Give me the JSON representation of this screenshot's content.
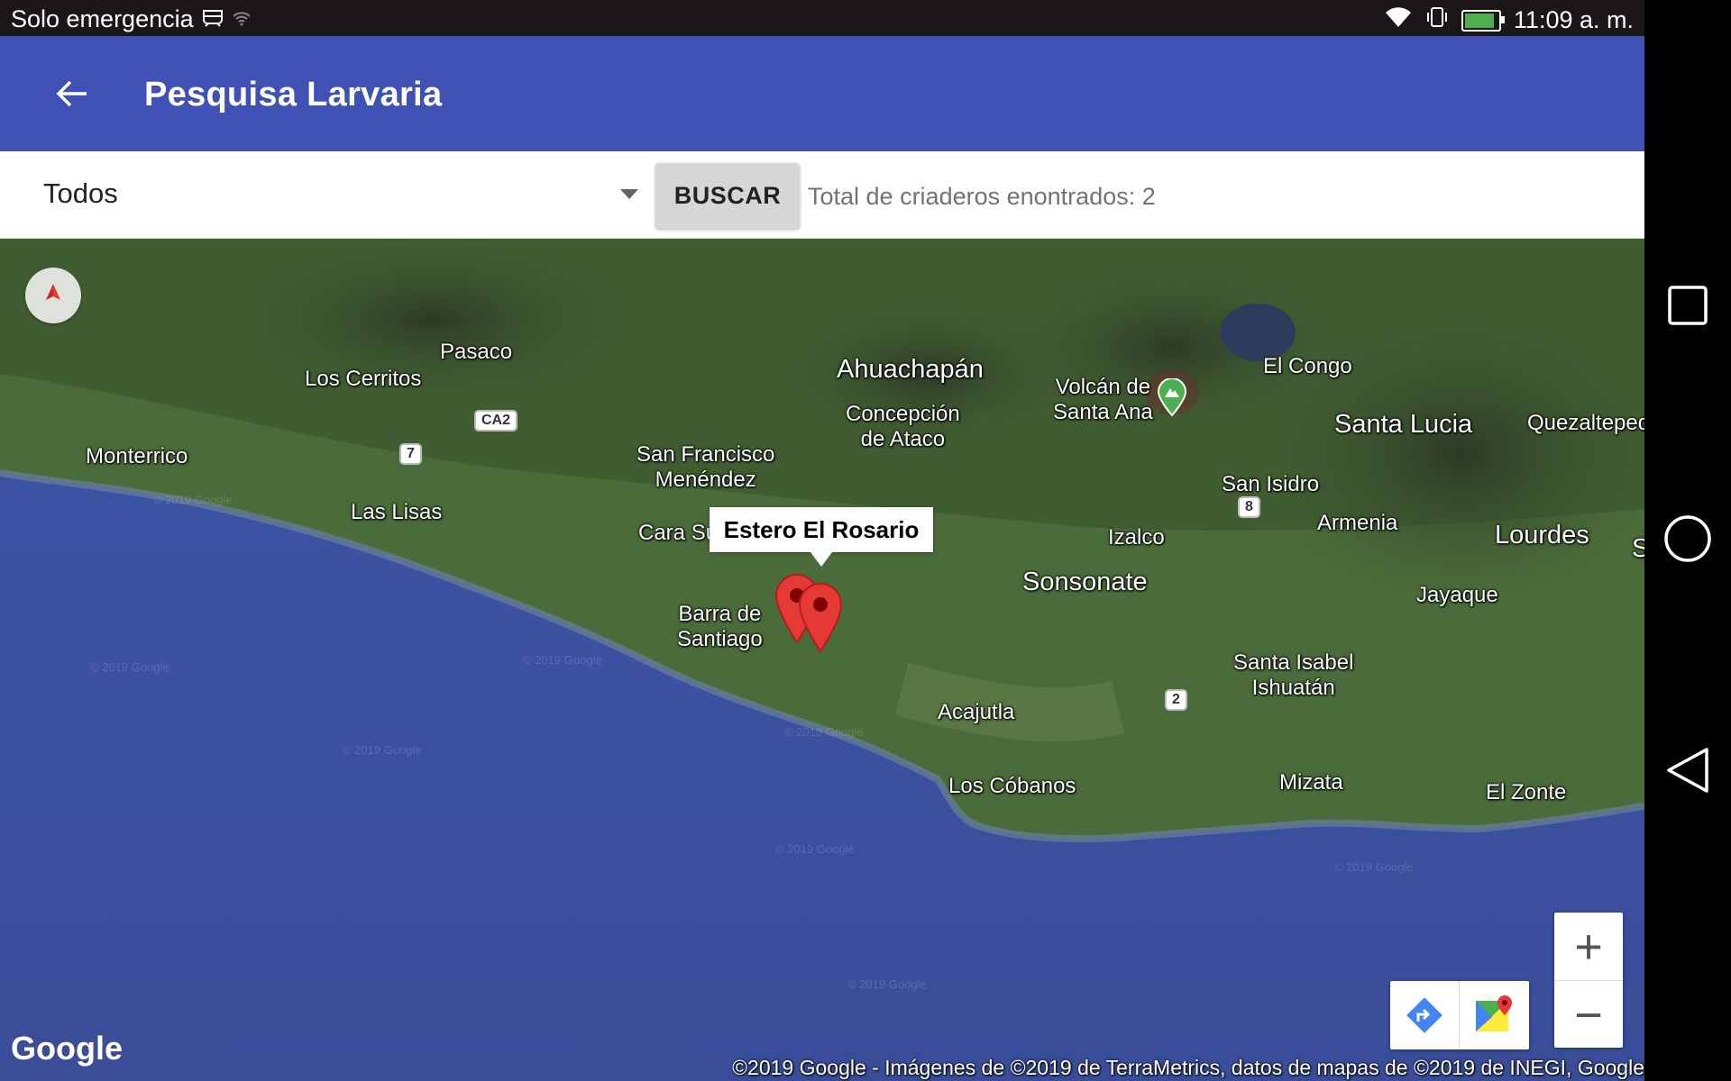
{
  "status_bar": {
    "carrier_text": "Solo emergencia",
    "time": "11:09 a. m.",
    "battery_level": 0.9
  },
  "app_bar": {
    "title": "Pesquisa Larvaria",
    "back_icon": "arrow-back-icon"
  },
  "filter": {
    "selected": "Todos",
    "button_label": "BUSCAR",
    "total_text": "Total de criaderos enontrados: 2"
  },
  "map": {
    "places": {
      "pasaco": "Pasaco",
      "los_cerritos": "Los Cerritos",
      "monterrico": "Monterrico",
      "las_lisas": "Las Lisas",
      "ahuachapan": "Ahuachapán",
      "concepcion": "Concepción\nde Ataco",
      "san_francisco": "San Francisco\nMenéndez",
      "cara_sucia": "Cara Su",
      "barra_santiago": "Barra de\nSantiago",
      "volcan": "Volcán de\nSanta Ana",
      "el_congo": "El Congo",
      "santa_lucia": "Santa Lucia",
      "quezaltepeque": "Quezaltepeq",
      "san_isidro": "San Isidro",
      "armenia": "Armenia",
      "izalco": "Izalco",
      "sonsonate": "Sonsonate",
      "lourdes": "Lourdes",
      "jayaque": "Jayaque",
      "santa_isabel": "Santa Isabel\nIshuatán",
      "acajutla": "Acajutla",
      "los_cobanos": "Los Cóbanos",
      "mizata": "Mizata",
      "el_zonte": "El Zonte",
      "edge_s": "S"
    },
    "road_shields": {
      "ca2": "CA2",
      "r7": "7",
      "r8": "8",
      "r2": "2"
    },
    "info_window": "Estero El Rosario",
    "google_logo": "Google",
    "copyright": "©2019 Google - Imágenes de ©2019 de TerraMetrics, datos de mapas de ©2019 de INEGI, Google",
    "watermark": "© 2019 Google",
    "zoom_in": "+",
    "zoom_out": "−"
  }
}
